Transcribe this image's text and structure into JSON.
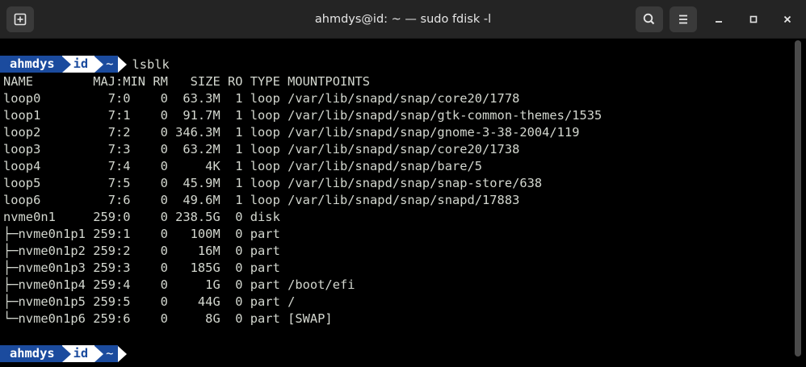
{
  "window": {
    "title": "ahmdys@id: ~ — sudo fdisk -l"
  },
  "icons": {
    "new_tab": "new-tab-icon",
    "search": "search-icon",
    "menu": "hamburger-menu-icon",
    "minimize": "minimize-icon",
    "maximize": "maximize-icon",
    "close": "close-icon"
  },
  "colors": {
    "prompt_blue": "#1b4b9e",
    "prompt_white": "#ffffff",
    "terminal_text": "#d3d7cf",
    "terminal_bg": "#000000",
    "headerbar_bg": "#242424"
  },
  "prompt": {
    "user": "ahmdys",
    "host": "id",
    "dir": "~"
  },
  "command": "lsblk",
  "header_line": "NAME        MAJ:MIN RM   SIZE RO TYPE MOUNTPOINTS",
  "rows": [
    "loop0         7:0    0  63.3M  1 loop /var/lib/snapd/snap/core20/1778",
    "loop1         7:1    0  91.7M  1 loop /var/lib/snapd/snap/gtk-common-themes/1535",
    "loop2         7:2    0 346.3M  1 loop /var/lib/snapd/snap/gnome-3-38-2004/119",
    "loop3         7:3    0  63.2M  1 loop /var/lib/snapd/snap/core20/1738",
    "loop4         7:4    0     4K  1 loop /var/lib/snapd/snap/bare/5",
    "loop5         7:5    0  45.9M  1 loop /var/lib/snapd/snap/snap-store/638",
    "loop6         7:6    0  49.6M  1 loop /var/lib/snapd/snap/snapd/17883",
    "nvme0n1     259:0    0 238.5G  0 disk",
    "├─nvme0n1p1 259:1    0   100M  0 part",
    "├─nvme0n1p2 259:2    0    16M  0 part",
    "├─nvme0n1p3 259:3    0   185G  0 part",
    "├─nvme0n1p4 259:4    0     1G  0 part /boot/efi",
    "├─nvme0n1p5 259:5    0    44G  0 part /",
    "└─nvme0n1p6 259:6    0     8G  0 part [SWAP]"
  ]
}
